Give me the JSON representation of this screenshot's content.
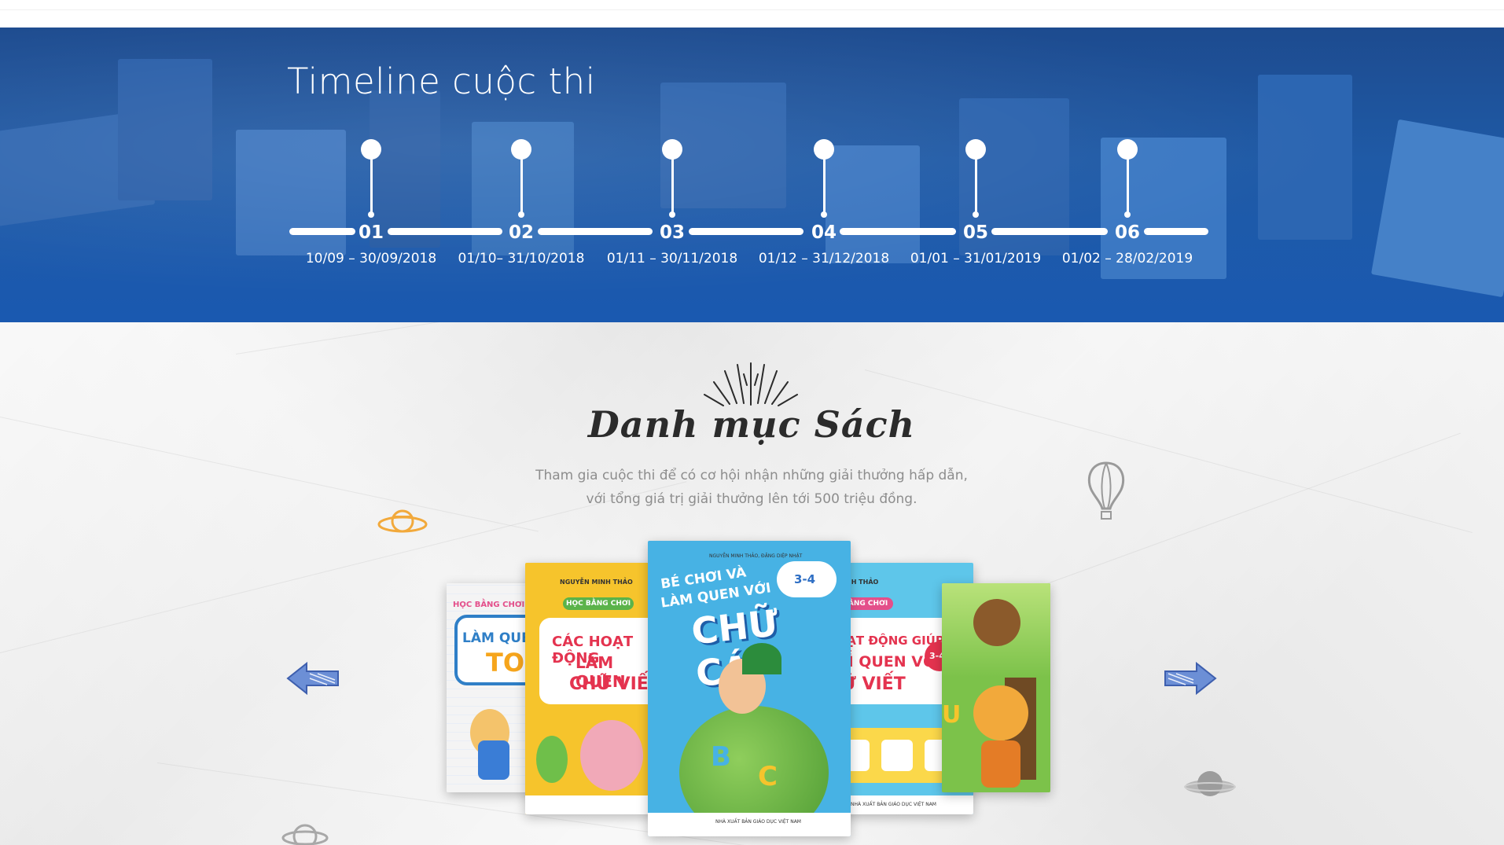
{
  "timeline": {
    "title": "Timeline cuộc thi",
    "steps": [
      {
        "num": "01",
        "date": "10/09 – 30/09/2018"
      },
      {
        "num": "02",
        "date": "01/10– 31/10/2018"
      },
      {
        "num": "03",
        "date": "01/11 – 30/11/2018"
      },
      {
        "num": "04",
        "date": "01/12 – 31/12/2018"
      },
      {
        "num": "05",
        "date": "01/01 – 31/01/2019"
      },
      {
        "num": "06",
        "date": "01/02 – 28/02/2019"
      }
    ]
  },
  "catalog": {
    "title": "Danh mục Sách",
    "description_line1": "Tham gia cuộc thi để có cơ hội nhận những giải thưởng hấp dẫn,",
    "description_line2": "với tổng giá trị giải thưởng lên tới 500 triệu đồng.",
    "books": [
      {
        "series": "HỌC BẰNG CHƠI",
        "line1": "LÀM QUEN V",
        "line2": "TO",
        "color": "#e44f8a"
      },
      {
        "author": "NGUYỄN MINH THẢO",
        "series": "HỌC BẰNG CHƠI",
        "line1": "CÁC HOẠT ĐỘNG",
        "line2": "LÀM QUEN",
        "line3": "CHỮ VIẾ",
        "color": "#f6c42c"
      },
      {
        "author": "NGUYỄN MINH THẢO, ĐẶNG DIỆP NHẬT",
        "line1": "BÉ CHƠI VÀ",
        "line2": "LÀM QUEN VỚI",
        "line3": "CHỮ CÁI",
        "age": "3-4",
        "publisher": "NHÀ XUẤT BẢN GIÁO DỤC VIỆT NAM",
        "color": "#47b2e4"
      },
      {
        "author": "NH THẢO",
        "series": "BẰNG CHƠI",
        "line1": "HOẠT ĐỘNG GIÚP TRẺ",
        "line2": "ÀM QUEN VỚI",
        "line3": "HỮ VIẾT",
        "age": "3-4",
        "publisher": "NHÀ XUẤT BẢN GIÁO DỤC VIỆT NAM",
        "color": "#5ec6ea"
      },
      {
        "line1": "U",
        "color": "#7cc24a"
      }
    ]
  },
  "icons": {
    "prev": "arrow-left-icon",
    "next": "arrow-right-icon",
    "planet": "planet-icon",
    "balloon": "balloon-icon"
  },
  "colors": {
    "hero_blue": "#1f5aa6",
    "accent_orange": "#f2a93b",
    "arrow_blue": "#4d74c4"
  }
}
